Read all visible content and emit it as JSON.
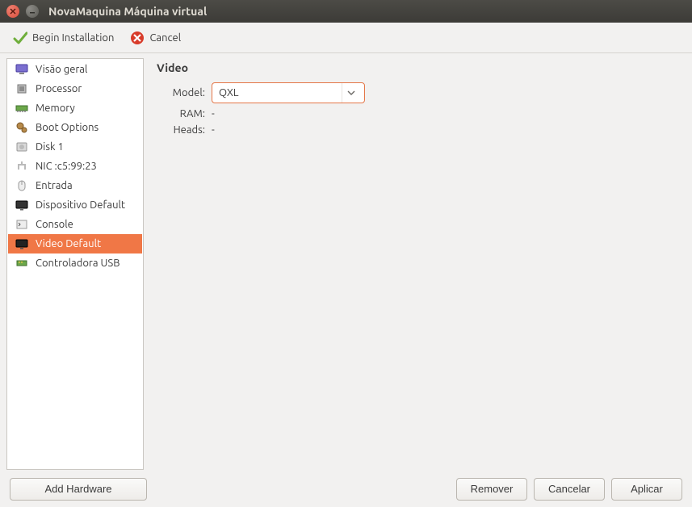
{
  "window": {
    "title": "NovaMaquina Máquina virtual"
  },
  "toolbar": {
    "begin_install": "Begin Installation",
    "cancel": "Cancel"
  },
  "sidebar": {
    "items": [
      {
        "label": "Visão geral",
        "icon": "monitor-icon"
      },
      {
        "label": "Processor",
        "icon": "cpu-icon"
      },
      {
        "label": "Memory",
        "icon": "ram-icon"
      },
      {
        "label": "Boot Options",
        "icon": "gears-icon"
      },
      {
        "label": "Disk 1",
        "icon": "disk-icon"
      },
      {
        "label": "NIC :c5:99:23",
        "icon": "nic-icon"
      },
      {
        "label": "Entrada",
        "icon": "mouse-icon"
      },
      {
        "label": "Dispositivo Default",
        "icon": "display-device-icon"
      },
      {
        "label": "Console",
        "icon": "console-icon"
      },
      {
        "label": "Video Default",
        "icon": "video-icon",
        "selected": true
      },
      {
        "label": "Controladora USB",
        "icon": "usb-icon"
      }
    ],
    "add_hardware": "Add Hardware"
  },
  "details": {
    "section_title": "Video",
    "model_label": "Model:",
    "model_value": "QXL",
    "ram_label": "RAM:",
    "ram_value": "-",
    "heads_label": "Heads:",
    "heads_value": "-"
  },
  "footer": {
    "remove": "Remover",
    "cancel": "Cancelar",
    "apply": "Aplicar"
  }
}
